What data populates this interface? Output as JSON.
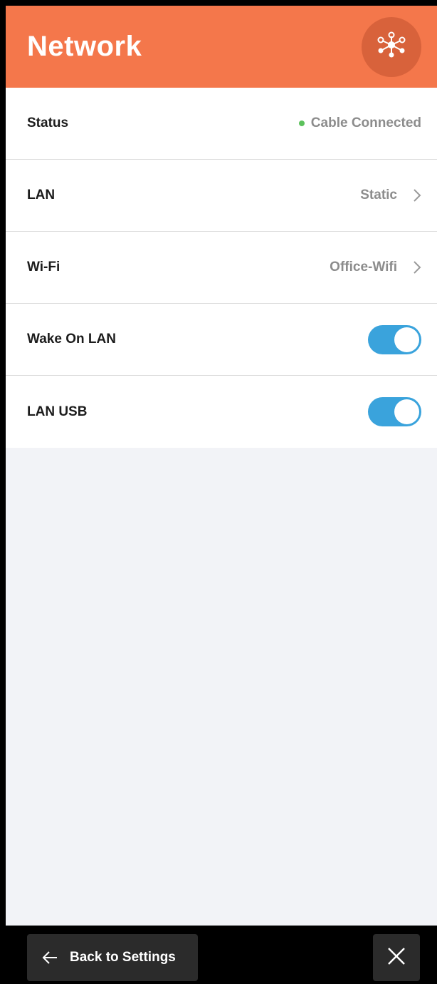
{
  "header": {
    "title": "Network",
    "icon": "network-nodes-icon",
    "color": "#f4774b"
  },
  "rows": [
    {
      "label": "Status",
      "value": "Cable Connected",
      "status_color": "#5cc15c"
    },
    {
      "label": "LAN",
      "value": "Static"
    },
    {
      "label": "Wi-Fi",
      "value": "Office-Wifi"
    },
    {
      "label": "Wake On LAN",
      "toggle_on": true
    },
    {
      "label": "LAN USB",
      "toggle_on": true
    }
  ],
  "footer": {
    "back_label": "Back to Settings",
    "back_icon": "arrow-left-icon",
    "close_icon": "close-icon"
  },
  "colors": {
    "toggle_on": "#3aa3dc"
  }
}
